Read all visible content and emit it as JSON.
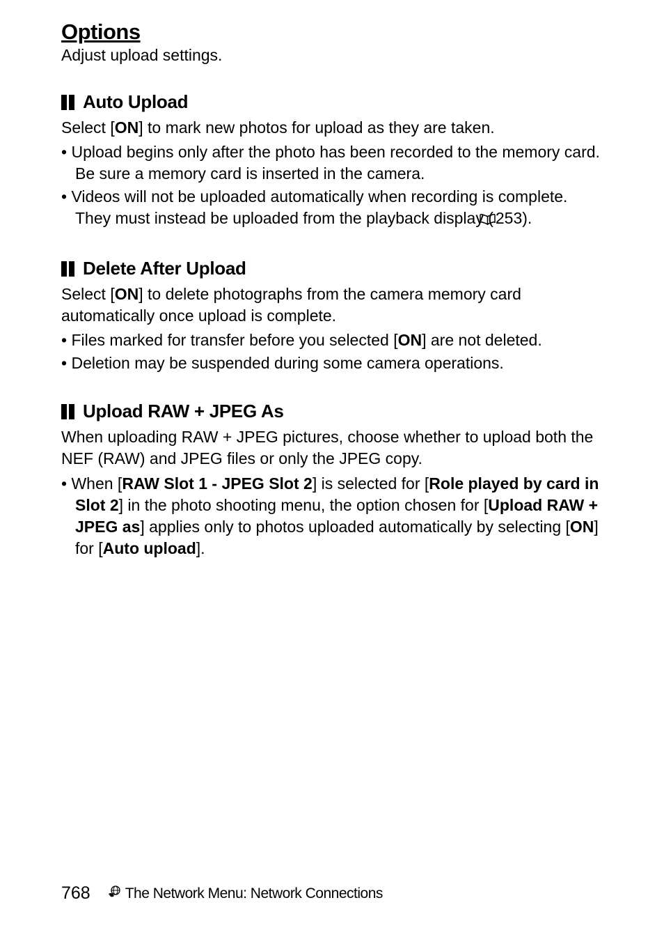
{
  "page_title": "Options",
  "page_subtitle": "Adjust upload settings.",
  "sections": [
    {
      "title": "Auto Upload",
      "intro_pre": "Select [",
      "intro_bold1": "ON",
      "intro_post": "] to mark new photos for upload as they are taken.",
      "bullets": [
        {
          "text": "Upload begins only after the photo has been recorded to the memory card. Be sure a memory card is inserted in the camera."
        },
        {
          "text_pre": "Videos will not be uploaded automatically when recording is complete. They must instead be uploaded from the playback display (",
          "ref": "253",
          "text_post": ")."
        }
      ]
    },
    {
      "title": "Delete After Upload",
      "intro_pre": "Select [",
      "intro_bold1": "ON",
      "intro_post": "] to delete photographs from the camera memory card automatically once upload is complete.",
      "bullets": [
        {
          "text_pre": "Files marked for transfer before you selected [",
          "bold1": "ON",
          "text_post": "] are not deleted."
        },
        {
          "text": "Deletion may be suspended during some camera operations."
        }
      ]
    },
    {
      "title": "Upload RAW + JPEG As",
      "intro_plain": "When uploading RAW + JPEG pictures, choose whether to upload both the NEF (RAW) and JPEG files or only the JPEG copy.",
      "bullets": [
        {
          "text_pre": "When [",
          "bold1": "RAW Slot 1 - JPEG Slot 2",
          "text_mid1": "] is selected for [",
          "bold2": "Role played by card in Slot 2",
          "text_mid2": "] in the photo shooting menu, the option chosen for [",
          "bold3": "Upload RAW + JPEG as",
          "text_mid3": "] applies only to photos uploaded automatically by selecting [",
          "bold4": "ON",
          "text_mid4": "] for [",
          "bold5": "Auto upload",
          "text_post": "]."
        }
      ]
    }
  ],
  "footer": {
    "page_number": "768",
    "title": "The Network Menu: Network Connections"
  }
}
